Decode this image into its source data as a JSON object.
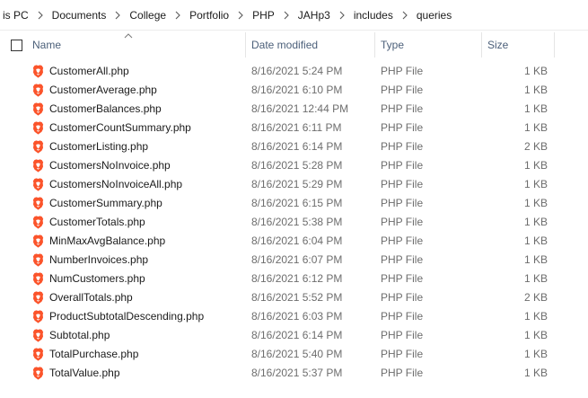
{
  "breadcrumb": {
    "items": [
      "is PC",
      "Documents",
      "College",
      "Portfolio",
      "PHP",
      "JAHp3",
      "includes",
      "queries"
    ]
  },
  "columns": {
    "name": "Name",
    "date_modified": "Date modified",
    "type": "Type",
    "size": "Size"
  },
  "sort": {
    "column": "name",
    "direction": "ascending"
  },
  "files": [
    {
      "name": "CustomerAll.php",
      "date": "8/16/2021 5:24 PM",
      "type": "PHP File",
      "size": "1 KB"
    },
    {
      "name": "CustomerAverage.php",
      "date": "8/16/2021 6:10 PM",
      "type": "PHP File",
      "size": "1 KB"
    },
    {
      "name": "CustomerBalances.php",
      "date": "8/16/2021 12:44 PM",
      "type": "PHP File",
      "size": "1 KB"
    },
    {
      "name": "CustomerCountSummary.php",
      "date": "8/16/2021 6:11 PM",
      "type": "PHP File",
      "size": "1 KB"
    },
    {
      "name": "CustomerListing.php",
      "date": "8/16/2021 6:14 PM",
      "type": "PHP File",
      "size": "2 KB"
    },
    {
      "name": "CustomersNoInvoice.php",
      "date": "8/16/2021 5:28 PM",
      "type": "PHP File",
      "size": "1 KB"
    },
    {
      "name": "CustomersNoInvoiceAll.php",
      "date": "8/16/2021 5:29 PM",
      "type": "PHP File",
      "size": "1 KB"
    },
    {
      "name": "CustomerSummary.php",
      "date": "8/16/2021 6:15 PM",
      "type": "PHP File",
      "size": "1 KB"
    },
    {
      "name": "CustomerTotals.php",
      "date": "8/16/2021 5:38 PM",
      "type": "PHP File",
      "size": "1 KB"
    },
    {
      "name": "MinMaxAvgBalance.php",
      "date": "8/16/2021 6:04 PM",
      "type": "PHP File",
      "size": "1 KB"
    },
    {
      "name": "NumberInvoices.php",
      "date": "8/16/2021 6:07 PM",
      "type": "PHP File",
      "size": "1 KB"
    },
    {
      "name": "NumCustomers.php",
      "date": "8/16/2021 6:12 PM",
      "type": "PHP File",
      "size": "1 KB"
    },
    {
      "name": "OverallTotals.php",
      "date": "8/16/2021 5:52 PM",
      "type": "PHP File",
      "size": "2 KB"
    },
    {
      "name": "ProductSubtotalDescending.php",
      "date": "8/16/2021 6:03 PM",
      "type": "PHP File",
      "size": "1 KB"
    },
    {
      "name": "Subtotal.php",
      "date": "8/16/2021 6:14 PM",
      "type": "PHP File",
      "size": "1 KB"
    },
    {
      "name": "TotalPurchase.php",
      "date": "8/16/2021 5:40 PM",
      "type": "PHP File",
      "size": "1 KB"
    },
    {
      "name": "TotalValue.php",
      "date": "8/16/2021 5:37 PM",
      "type": "PHP File",
      "size": "1 KB"
    }
  ],
  "icons": {
    "file_icon": "brave-browser-file-icon",
    "breadcrumb_separator": "chevron-right-icon",
    "sort_indicator": "chevron-up-icon"
  },
  "colors": {
    "brand_icon": "#fb542b",
    "header_text": "#4c607a",
    "secondary_text": "#6d6d6d"
  }
}
